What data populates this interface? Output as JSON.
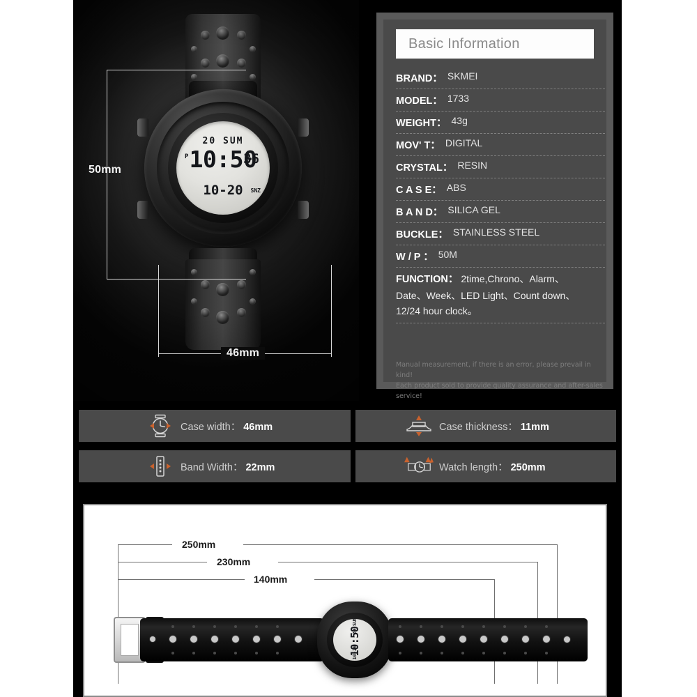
{
  "spec_card": {
    "title": "Basic Information",
    "rows": [
      {
        "key": "BRAND：",
        "value": "SKMEI"
      },
      {
        "key": "MODEL：",
        "value": "1733"
      },
      {
        "key": "WEIGHT：",
        "value": "43g"
      },
      {
        "key": "MOV' T：",
        "value": "DIGITAL"
      },
      {
        "key": "CRYSTAL：",
        "value": "RESIN"
      },
      {
        "key": "C A S E：",
        "value": "ABS"
      },
      {
        "key": "B A N D：",
        "value": "SILICA GEL"
      },
      {
        "key": "BUCKLE：",
        "value": "STAINLESS STEEL"
      },
      {
        "key": "W / P ：",
        "value": "50M"
      }
    ],
    "function": {
      "key": "FUNCTION：",
      "line1": "2time,Chrono、Alarm、",
      "line2": "Date、Week、LED Light、Count down、",
      "line3": "12/24 hour clock。"
    },
    "disclaimer_line1": "Manual measurement, if there is an error, please prevail in kind!",
    "disclaimer_line2": "Each product sold to provide quality assurance and after-sales service!"
  },
  "photo": {
    "dim_height": "50mm",
    "dim_width": "46mm",
    "lcd": {
      "date": "20 SUM",
      "pm_indicator": "P",
      "time": "10:50",
      "seconds": "36",
      "alarm": "10-20",
      "snooze": "SNZ"
    }
  },
  "info_bar": {
    "items": [
      {
        "icon": "watch-face-icon",
        "label": "Case width：",
        "value": "46mm"
      },
      {
        "icon": "case-profile-icon",
        "label": "Case thickness：",
        "value": "11mm"
      },
      {
        "icon": "band-strip-icon",
        "label": "Band Width：",
        "value": "22mm"
      },
      {
        "icon": "watch-length-icon",
        "label": "Watch length：",
        "value": "250mm"
      }
    ]
  },
  "bottom_panel": {
    "dim_total": "250mm",
    "dim_mid": "230mm",
    "dim_short": "140mm",
    "lcd": {
      "date": "20 SUM",
      "time": "10:50",
      "seconds": "36",
      "alarm": "10-20"
    }
  },
  "colors": {
    "accent_orange": "#c9622e",
    "panel_dark": "#4a4a4a",
    "panel_mid": "#5a5a5a",
    "background": "#000000"
  }
}
